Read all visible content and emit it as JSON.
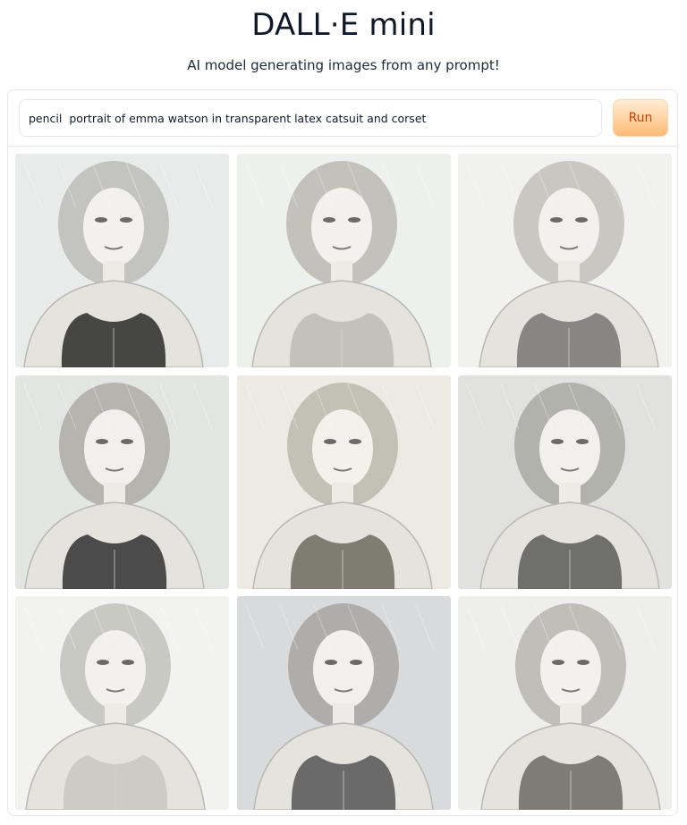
{
  "header": {
    "title": "DALL·E mini",
    "subtitle": "AI model generating images from any prompt!"
  },
  "prompt": {
    "value": "pencil  portrait of emma watson in transparent latex catsuit and corset",
    "run_label": "Run"
  },
  "gallery": {
    "images": [
      {
        "name": "generated-image-1",
        "tone": "#e9eaea",
        "hair": "#a4a29c",
        "outfit": "#2a2a2a"
      },
      {
        "name": "generated-image-2",
        "tone": "#eef0ee",
        "hair": "#9e9c92",
        "outfit": "#bdbcb4"
      },
      {
        "name": "generated-image-3",
        "tone": "#f1f1ef",
        "hair": "#a8a49a",
        "outfit": "#777676"
      },
      {
        "name": "generated-image-4",
        "tone": "#e3e5e2",
        "hair": "#8f8c84",
        "outfit": "#2f3030"
      },
      {
        "name": "generated-image-5",
        "tone": "#eceae3",
        "hair": "#a39e90",
        "outfit": "#6d6a5f"
      },
      {
        "name": "generated-image-6",
        "tone": "#e1e2e0",
        "hair": "#8d8a84",
        "outfit": "#5a5a58"
      },
      {
        "name": "generated-image-7",
        "tone": "#f2f3f1",
        "hair": "#a8a69e",
        "outfit": "#c9c7bf"
      },
      {
        "name": "generated-image-8",
        "tone": "#d9dadb",
        "hair": "#8a8884",
        "outfit": "#555556"
      },
      {
        "name": "generated-image-9",
        "tone": "#eeeeec",
        "hair": "#9a978e",
        "outfit": "#6c6a62"
      }
    ]
  }
}
